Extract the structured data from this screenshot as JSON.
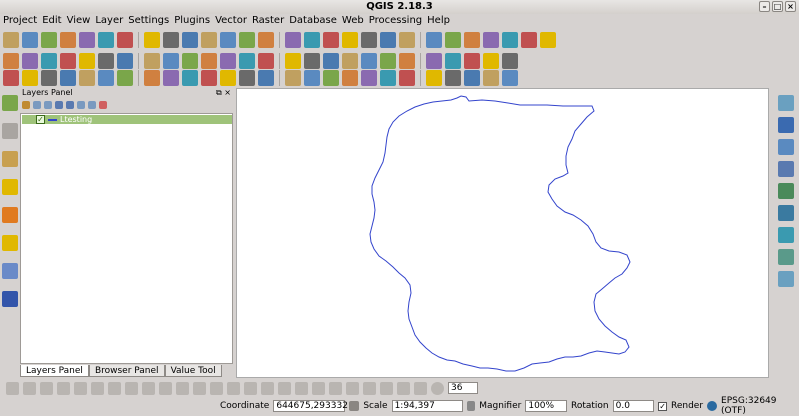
{
  "window": {
    "title": "QGIS 2.18.3"
  },
  "menu": [
    "Project",
    "Edit",
    "View",
    "Layer",
    "Settings",
    "Plugins",
    "Vector",
    "Raster",
    "Database",
    "Web",
    "Processing",
    "Help"
  ],
  "colors": {
    "accent_green": "#9fc37a",
    "map_line": "#3344cc"
  },
  "toolbar_rows": [
    {
      "row": 1,
      "icons": [
        "hand",
        "new-project",
        "open-project",
        "save-project",
        "save-as",
        "print-composer",
        "pan",
        "pan-to-selection",
        "zoom-in",
        "zoom-out",
        "zoom-native",
        "zoom-full",
        "zoom-layer",
        "zoom-selection",
        "zoom-last",
        "zoom-next",
        "new-bookmark",
        "refresh",
        "identify",
        "select",
        "deselect",
        "attribute-table",
        "field-calculator",
        "statistics",
        "measure",
        "annotation",
        "text-annotation",
        "help"
      ]
    },
    {
      "row": 2,
      "icons": [
        "edit-pencil",
        "toggle-editing",
        "save-edits",
        "add-feature",
        "move-feature",
        "node-tool",
        "delete-selected",
        "cut",
        "copy",
        "paste",
        "db-manager",
        "csv",
        "python",
        "identify-plus",
        "spatial",
        "py",
        "plugin",
        "osm",
        "wkt",
        "qgis-plugin",
        "label",
        "undo",
        "digitize",
        "python-console",
        "processing",
        "settings"
      ]
    },
    {
      "row": 3,
      "icons": [
        "add-raster",
        "add-vector",
        "add-spatialite",
        "add-wms",
        "qgis-gear",
        "add-postgis",
        "add-wcs",
        "table",
        "calendar",
        "lat-long",
        "add-wfs",
        "grid",
        "mesh",
        "wave",
        "georef",
        "atlas",
        "location",
        "arrow-tool",
        "grid-plus",
        "leaf-1",
        "leaf-2",
        "leaf-3",
        "find",
        "slider",
        "lynx",
        "composite"
      ]
    }
  ],
  "layers_panel": {
    "title": "Layers Panel",
    "layer": {
      "name": "Ltesting",
      "checked": true
    }
  },
  "tabs": [
    "Layers Panel",
    "Browser Panel",
    "Value Tool"
  ],
  "status": {
    "coordinate_label": "Coordinate",
    "coordinate_value": "644675,293332",
    "scale_label": "Scale",
    "scale_value": "1:94,397",
    "magnifier_label": "Magnifier",
    "magnifier_value": "100%",
    "rotation_label": "Rotation",
    "rotation_value": "0.0",
    "render_label": "Render",
    "render_checked": true,
    "crs": "EPSG:32649 (OTF)"
  },
  "digitize_bar": {
    "zoom_value": "36"
  }
}
